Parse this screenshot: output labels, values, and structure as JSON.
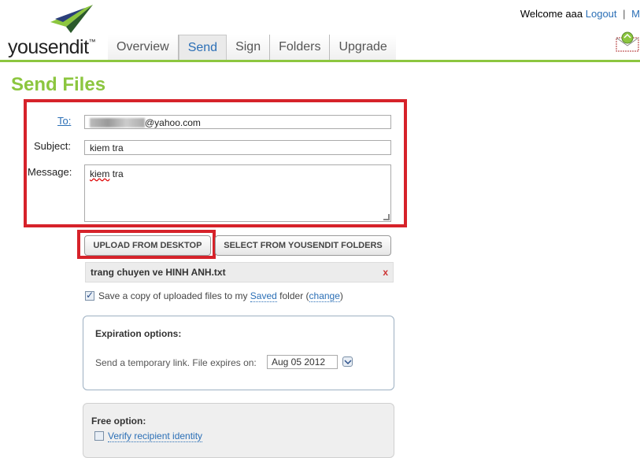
{
  "header": {
    "logo_text": "yousendit",
    "logo_tm": "™",
    "welcome": "Welcome aaa",
    "logout": "Logout",
    "separator": "|",
    "extra": "M"
  },
  "tabs": [
    {
      "label": "Overview",
      "active": false
    },
    {
      "label": "Send",
      "active": true
    },
    {
      "label": "Sign",
      "active": false
    },
    {
      "label": "Folders",
      "active": false
    },
    {
      "label": "Upgrade",
      "active": false
    }
  ],
  "page": {
    "title": "Send Files"
  },
  "form": {
    "to_label": "To:",
    "to_value": "@yahoo.com",
    "subject_label": "Subject:",
    "subject_value": "kiem tra",
    "message_label": "Message:",
    "message_word1": "kiem",
    "message_word2": "tra"
  },
  "buttons": {
    "upload": "UPLOAD FROM DESKTOP",
    "select": "SELECT FROM YOUSENDIT FOLDERS"
  },
  "file": {
    "name": "trang chuyen ve HINH ANH.txt",
    "remove": "x"
  },
  "save_copy": {
    "checked": true,
    "text_before": "Save a copy of uploaded files to my",
    "saved_link": "Saved",
    "text_mid": "folder (",
    "change_link": "change",
    "text_after": ")"
  },
  "expiration": {
    "title": "Expiration options:",
    "text": "Send a temporary link. File expires on:",
    "date": "Aug 05 2012"
  },
  "free_option": {
    "title": "Free option:",
    "verify_label": "Verify recipient identity",
    "checked": false
  },
  "colors": {
    "brand_green": "#8cc63f",
    "link_blue": "#2b6fb6",
    "highlight_red": "#d6222a"
  }
}
